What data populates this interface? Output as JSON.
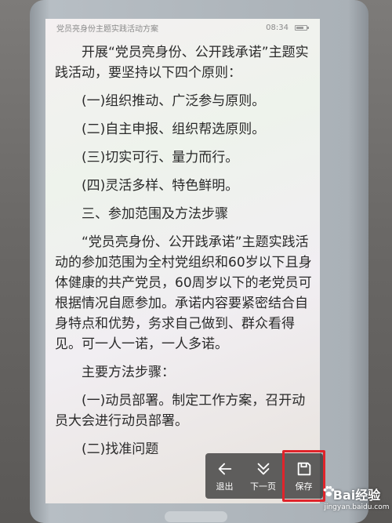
{
  "status_bar": {
    "doc_title": "党员亮身份主题实践活动方案",
    "time": "08:34"
  },
  "document": {
    "paragraphs": [
      "开展“党员亮身份、公开践承诺”主题实践活动，要坚持以下四个原则：",
      "(一)组织推动、广泛参与原则。",
      "(二)自主申报、组织帮选原则。",
      "(三)切实可行、量力而行。",
      "(四)灵活多样、特色鲜明。",
      "三、参加范围及方法步骤",
      "“党员亮身份、公开践承诺”主题实践活动的参加范围为全村党组织和60岁以下且身体健康的共产党员，60周岁以下的老党员可根据情况自愿参加。承诺内容要紧密结合自身特点和优势，务求自己做到、群众看得见。可一人一诺，一人多诺。",
      "主要方法步骤：",
      "(一)动员部署。制定工作方案，召开动员大会进行动员部署。",
      "(二)找准问题"
    ]
  },
  "toolbar": {
    "exit_label": "退出",
    "next_label": "下一页",
    "save_label": "保存"
  },
  "watermark": {
    "title": "Bai经验",
    "url": "jingyan.baidu.com"
  },
  "colors": {
    "highlight": "#e0242b",
    "toolbar_bg": "#282828"
  }
}
